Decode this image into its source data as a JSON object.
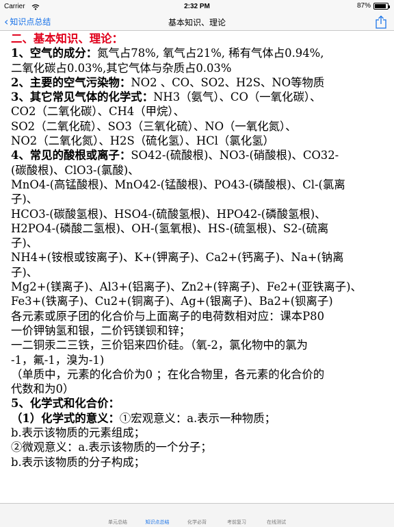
{
  "status_bar": {
    "carrier": "Carrier",
    "wifi_icon": "wifi-icon",
    "time": "2:32 PM",
    "battery_text": "87%",
    "battery_level": 0.87
  },
  "nav": {
    "back_label": "知识点总结",
    "title": "基本知识、理论",
    "back_icon": "chevron-left-icon",
    "share_icon": "share-icon",
    "accent": "#1a73e8"
  },
  "content": {
    "lines": [
      "二、基本知识、理论：",
      "1、空气的成分：氮气占78%, 氧气占21%, 稀有气体占0.94%,",
      "二氧化碳占0.03%,其它气体与杂质占0.03%",
      "2、主要的空气污染物：NO2 、CO、SO2、H2S、NO等物质",
      "3、其它常见气体的化学式：NH3（氨气）、CO（一氧化碳）、",
      "CO2（二氧化碳）、CH4（甲烷）、",
      "SO2（二氧化硫）、SO3（三氧化硫）、NO（一氧化氮）、",
      "NO2（二氧化氮）、H2S（硫化氢）、HCl（氯化氢）",
      "4、常见的酸根或离子：SO42-(硫酸根)、NO3-(硝酸根)、CO32-",
      "(碳酸根)、ClO3-(氯酸)、",
      "MnO4-(高锰酸根)、MnO42-(锰酸根)、PO43-(磷酸根)、Cl-(氯离",
      "子)、",
      "HCO3-(碳酸氢根)、HSO4-(硫酸氢根)、HPO42-(磷酸氢根)、",
      "H2PO4-(磷酸二氢根)、OH-(氢氧根)、HS-(硫氢根)、S2-(硫离",
      "子)、",
      "NH4+(铵根或铵离子)、K+(钾离子)、Ca2+(钙离子)、Na+(钠离",
      "子)、",
      "Mg2+(镁离子)、Al3+(铝离子)、Zn2+(锌离子)、Fe2+(亚铁离子)、",
      "Fe3+(铁离子)、Cu2+(铜离子)、Ag+(银离子)、Ba2+(钡离子)",
      "各元素或原子团的化合价与上面离子的电荷数相对应：课本P80",
      "一价钾钠氢和银，二价钙镁钡和锌；",
      "一二铜汞二三铁，三价铝来四价硅。（氧-2，氯化物中的氯为",
      "-1，氟-1，溴为-1)",
      "（单质中，元素的化合价为0 ；在化合物里，各元素的化合价的",
      "代数和为0）",
      "5、化学式和化合价：",
      "（1）化学式的意义：①宏观意义：a.表示一种物质；",
      "b.表示该物质的元素组成；",
      "②微观意义：a.表示该物质的一个分子；",
      "b.表示该物质的分子构成；"
    ],
    "heading_color": "#e0001b"
  },
  "tabs": {
    "items": [
      {
        "label": "单元总结"
      },
      {
        "label": "知识点总结"
      },
      {
        "label": "化学必背"
      },
      {
        "label": "考前复习"
      },
      {
        "label": "在线测试"
      }
    ],
    "active_index": 1
  }
}
